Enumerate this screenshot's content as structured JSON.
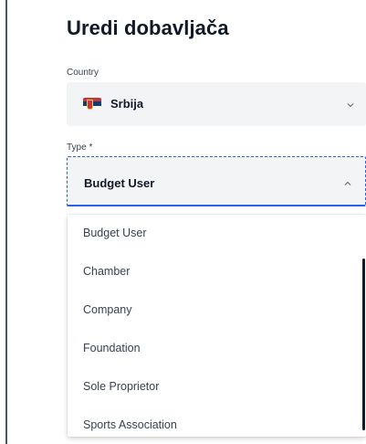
{
  "header": {
    "title": "Uredi dobavljača"
  },
  "country": {
    "label": "Country",
    "value": "Srbija",
    "flag_icon": "serbia-flag-icon",
    "chevron_icon": "chevron-down-icon"
  },
  "type": {
    "label": "Type *",
    "value": "Budget User",
    "chevron_icon": "chevron-up-icon",
    "focus_color": "#2563eb"
  },
  "dropdown": {
    "options": [
      "Budget User",
      "Chamber",
      "Company",
      "Foundation",
      "Sole Proprietor",
      "Sports Association"
    ]
  }
}
